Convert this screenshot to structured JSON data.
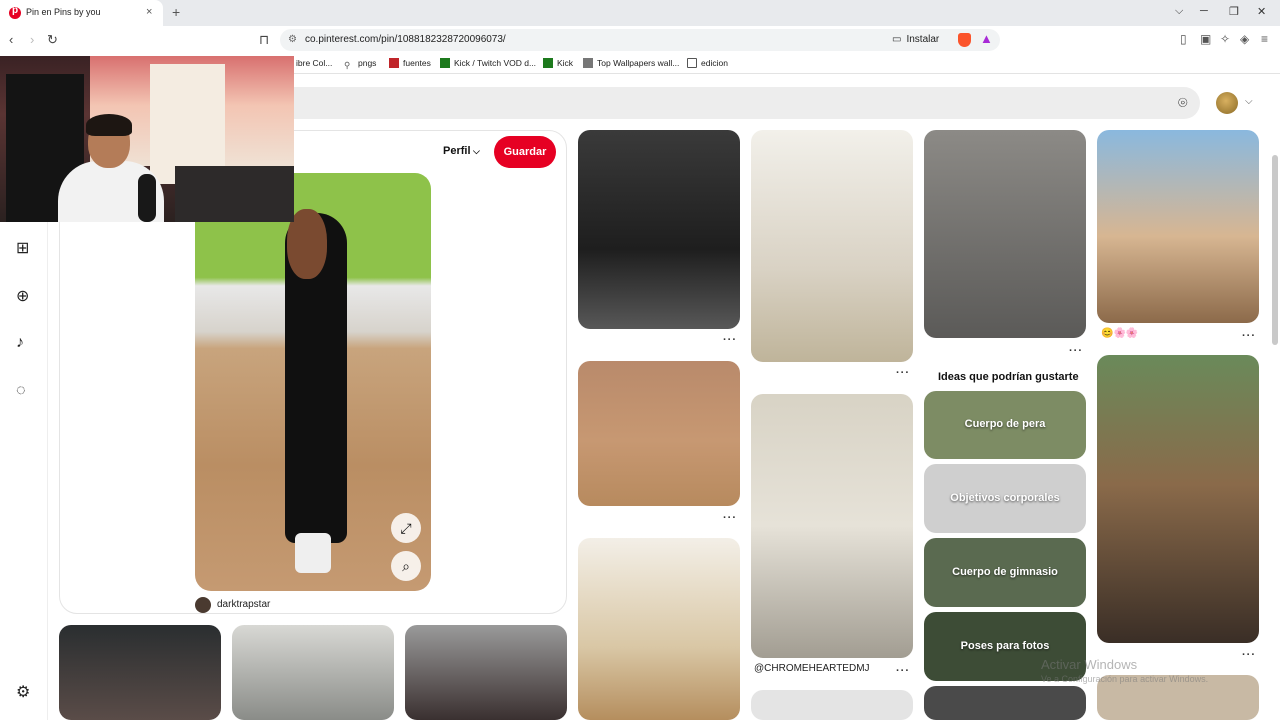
{
  "browser": {
    "tab_title": "Pin en Pins by you",
    "tab_close": "×",
    "new_tab": "+",
    "url": "co.pinterest.com/pin/1088182328720096073/",
    "install_label": "Instalar",
    "bookmarks": [
      {
        "label": "ibre Col...",
        "icon": "bookmark-icon"
      },
      {
        "label": "pngs",
        "icon": "pin-icon"
      },
      {
        "label": "fuentes",
        "icon": "dafont-icon"
      },
      {
        "label": "Kick / Twitch VOD d...",
        "icon": "kick-icon"
      },
      {
        "label": "Kick",
        "icon": "kick-icon"
      },
      {
        "label": "Top Wallpapers wall...",
        "icon": "wallpaper-icon"
      },
      {
        "label": "edicion",
        "icon": "folder-icon"
      }
    ]
  },
  "pin": {
    "profile_label": "Perfil",
    "save_label": "Guardar",
    "creator": "darktrapstar"
  },
  "feed": {
    "caption_chrome": "@CHROMEHEARTEDMJ",
    "ideas_title": "Ideas que podrían gustarte",
    "ideas": [
      {
        "label": "Cuerpo de pera",
        "color": "#7d8c64"
      },
      {
        "label": "Objetivos corporales",
        "color": "#cfcfcf"
      },
      {
        "label": "Cuerpo de gimnasio",
        "color": "#5a6a50"
      },
      {
        "label": "Poses para fotos",
        "color": "#3d4c36"
      }
    ],
    "emoji_row": "😊🌸🌸"
  },
  "watermark": {
    "title": "Activar Windows",
    "subtitle": "Ve a Configuración para activar Windows."
  },
  "colors": {
    "brand_red": "#e60023",
    "search_bg": "#ededed"
  }
}
